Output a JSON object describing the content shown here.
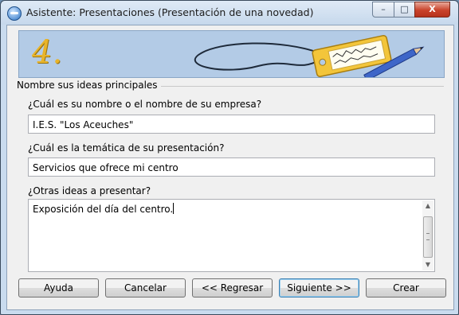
{
  "window": {
    "title": "Asistente: Presentaciones (Presentación de una novedad)",
    "controls": {
      "minimize": "–",
      "maximize": "□",
      "close": "X"
    }
  },
  "banner": {
    "step_number": "4."
  },
  "section": {
    "legend": "Nombre sus ideas principales"
  },
  "fields": {
    "company": {
      "label": "¿Cuál es su nombre o el nombre de su empresa?",
      "value": "I.E.S. \"Los Aceuches\""
    },
    "topic": {
      "label": "¿Cuál es la temática de su presentación?",
      "value": "Servicios que ofrece mi centro"
    },
    "ideas": {
      "label": "¿Otras ideas a presentar?",
      "value": "Exposición del día del centro."
    }
  },
  "buttons": {
    "help": "Ayuda",
    "cancel": "Cancelar",
    "back": "<< Regresar",
    "next": "Siguiente >>",
    "create": "Crear"
  },
  "icons": {
    "app": "wizard-app-icon",
    "banner_art": "luggage-tag-with-pencil"
  },
  "colors": {
    "accent": "#e8b42a",
    "banner_bg": "#b3cbe6",
    "close_button": "#c9422a"
  }
}
